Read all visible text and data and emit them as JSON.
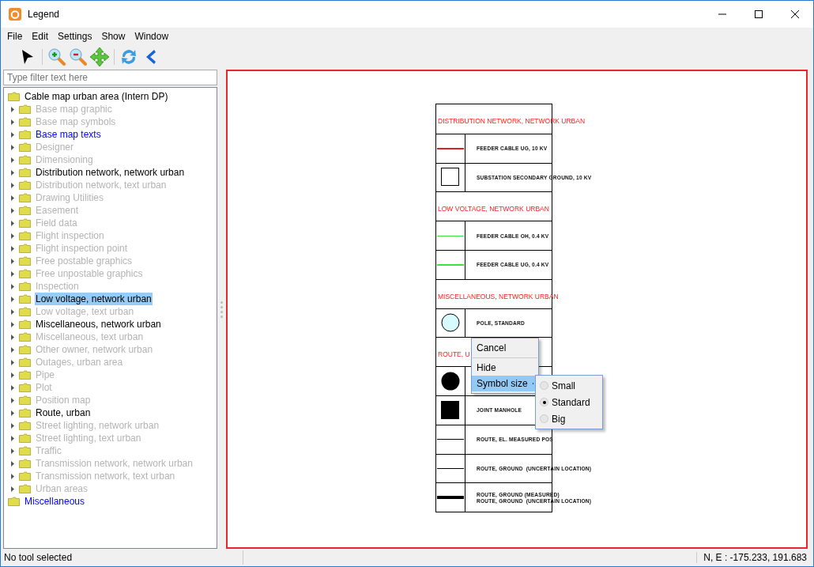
{
  "window": {
    "title": "Legend"
  },
  "menu": [
    "File",
    "Edit",
    "Settings",
    "Show",
    "Window"
  ],
  "filter": {
    "placeholder": "Type filter text here"
  },
  "tree": [
    {
      "label": "Cable map urban area (Intern DP)",
      "kind": "normal",
      "selected": false,
      "children": [
        {
          "label": "Base map graphic",
          "kind": "dimmed",
          "selected": false,
          "expanded": false
        },
        {
          "label": "Base map symbols",
          "kind": "dimmed",
          "selected": false,
          "expanded": false
        },
        {
          "label": "Base map texts",
          "kind": "highlighted",
          "selected": false,
          "expanded": false
        },
        {
          "label": "Designer",
          "kind": "dimmed",
          "selected": false,
          "expanded": false
        },
        {
          "label": "Dimensioning",
          "kind": "dimmed",
          "selected": false,
          "expanded": false
        },
        {
          "label": "Distribution network, network urban",
          "kind": "normal",
          "selected": false,
          "expanded": false
        },
        {
          "label": "Distribution network, text urban",
          "kind": "dimmed",
          "selected": false,
          "expanded": false
        },
        {
          "label": "Drawing Utilities",
          "kind": "dimmed",
          "selected": false,
          "expanded": false
        },
        {
          "label": "Easement",
          "kind": "dimmed",
          "selected": false,
          "expanded": false
        },
        {
          "label": "Field data",
          "kind": "dimmed",
          "selected": false,
          "expanded": false
        },
        {
          "label": "Flight inspection",
          "kind": "dimmed",
          "selected": false,
          "expanded": false
        },
        {
          "label": "Flight inspection point",
          "kind": "dimmed",
          "selected": false,
          "expanded": false
        },
        {
          "label": "Free postable graphics",
          "kind": "dimmed",
          "selected": false,
          "expanded": false
        },
        {
          "label": "Free unpostable graphics",
          "kind": "dimmed",
          "selected": false,
          "expanded": false
        },
        {
          "label": "Inspection",
          "kind": "dimmed",
          "selected": false,
          "expanded": false
        },
        {
          "label": "Low voltage, network urban",
          "kind": "normal",
          "selected": true,
          "expanded": false
        },
        {
          "label": "Low voltage, text urban",
          "kind": "dimmed",
          "selected": false,
          "expanded": false
        },
        {
          "label": "Miscellaneous, network urban",
          "kind": "normal",
          "selected": false,
          "expanded": false
        },
        {
          "label": "Miscellaneous, text urban",
          "kind": "dimmed",
          "selected": false,
          "expanded": false
        },
        {
          "label": "Other owner, network urban",
          "kind": "dimmed",
          "selected": false,
          "expanded": false
        },
        {
          "label": "Outages, urban area",
          "kind": "dimmed",
          "selected": false,
          "expanded": false
        },
        {
          "label": "Pipe",
          "kind": "dimmed",
          "selected": false,
          "expanded": false
        },
        {
          "label": "Plot",
          "kind": "dimmed",
          "selected": false,
          "expanded": false
        },
        {
          "label": "Position map",
          "kind": "dimmed",
          "selected": false,
          "expanded": false
        },
        {
          "label": "Route, urban",
          "kind": "normal",
          "selected": false,
          "expanded": false
        },
        {
          "label": "Street lighting, network urban",
          "kind": "dimmed",
          "selected": false,
          "expanded": false
        },
        {
          "label": "Street lighting, text urban",
          "kind": "dimmed",
          "selected": false,
          "expanded": false
        },
        {
          "label": "Traffic",
          "kind": "dimmed",
          "selected": false,
          "expanded": false
        },
        {
          "label": "Transmission network, network urban",
          "kind": "dimmed",
          "selected": false,
          "expanded": false
        },
        {
          "label": "Transmission network, text urban",
          "kind": "dimmed",
          "selected": false,
          "expanded": false
        },
        {
          "label": "Urban areas",
          "kind": "dimmed",
          "selected": false,
          "expanded": false
        }
      ]
    },
    {
      "label": "Miscellaneous",
      "kind": "highlighted",
      "selected": false
    }
  ],
  "legend": [
    {
      "kind": "header",
      "label": "DISTRIBUTION NETWORK, NETWORK URBAN"
    },
    {
      "kind": "boldline",
      "color": "#e02020",
      "labels": [
        "FEEDER CABLE UG, 10 KV"
      ]
    },
    {
      "kind": "square",
      "labels": [
        "SUBSTATION SECONDARY GROUND, 10 KV"
      ]
    },
    {
      "kind": "header",
      "label": "LOW VOLTAGE, NETWORK URBAN"
    },
    {
      "kind": "line",
      "color": "#40e040",
      "labels": [
        "FEEDER CABLE OH, 0.4 KV"
      ]
    },
    {
      "kind": "boldline",
      "color": "#40e040",
      "labels": [
        "FEEDER CABLE UG, 0.4 KV"
      ]
    },
    {
      "kind": "header",
      "label": "MISCELLANEOUS, NETWORK URBAN"
    },
    {
      "kind": "circle",
      "color": "#d8fbff",
      "labels": [
        "POLE, STANDARD"
      ]
    },
    {
      "kind": "header",
      "label": "ROUTE, U"
    },
    {
      "kind": "dot"
    },
    {
      "kind": "block",
      "labels": [
        "JOINT MANHOLE"
      ]
    },
    {
      "kind": "line",
      "color": "#000000",
      "labels": [
        "ROUTE, EL. MEASURED POS"
      ]
    },
    {
      "kind": "line",
      "color": "#000000",
      "labels": [
        "ROUTE, GROUND  (UNCERTAIN LOCATION)"
      ]
    },
    {
      "kind": "heavyline",
      "color": "#000000",
      "labels": [
        "ROUTE, GROUND (MEASURED)",
        "ROUTE, GROUND  (UNCERTAIN LOCATION)"
      ]
    }
  ],
  "context_menu": [
    {
      "kind": "item",
      "label": "Cancel",
      "selected": false
    },
    {
      "kind": "separator"
    },
    {
      "kind": "item",
      "label": "Hide",
      "selected": false
    },
    {
      "kind": "submenu",
      "label": "Symbol size",
      "selected": true
    }
  ],
  "submenu": [
    {
      "label": "Small",
      "selected": false
    },
    {
      "label": "Standard",
      "selected": true
    },
    {
      "label": "Big",
      "selected": false
    }
  ],
  "status_bar": {
    "message": "No tool selected",
    "coordinates": "N, E : -175.233, 191.683"
  }
}
